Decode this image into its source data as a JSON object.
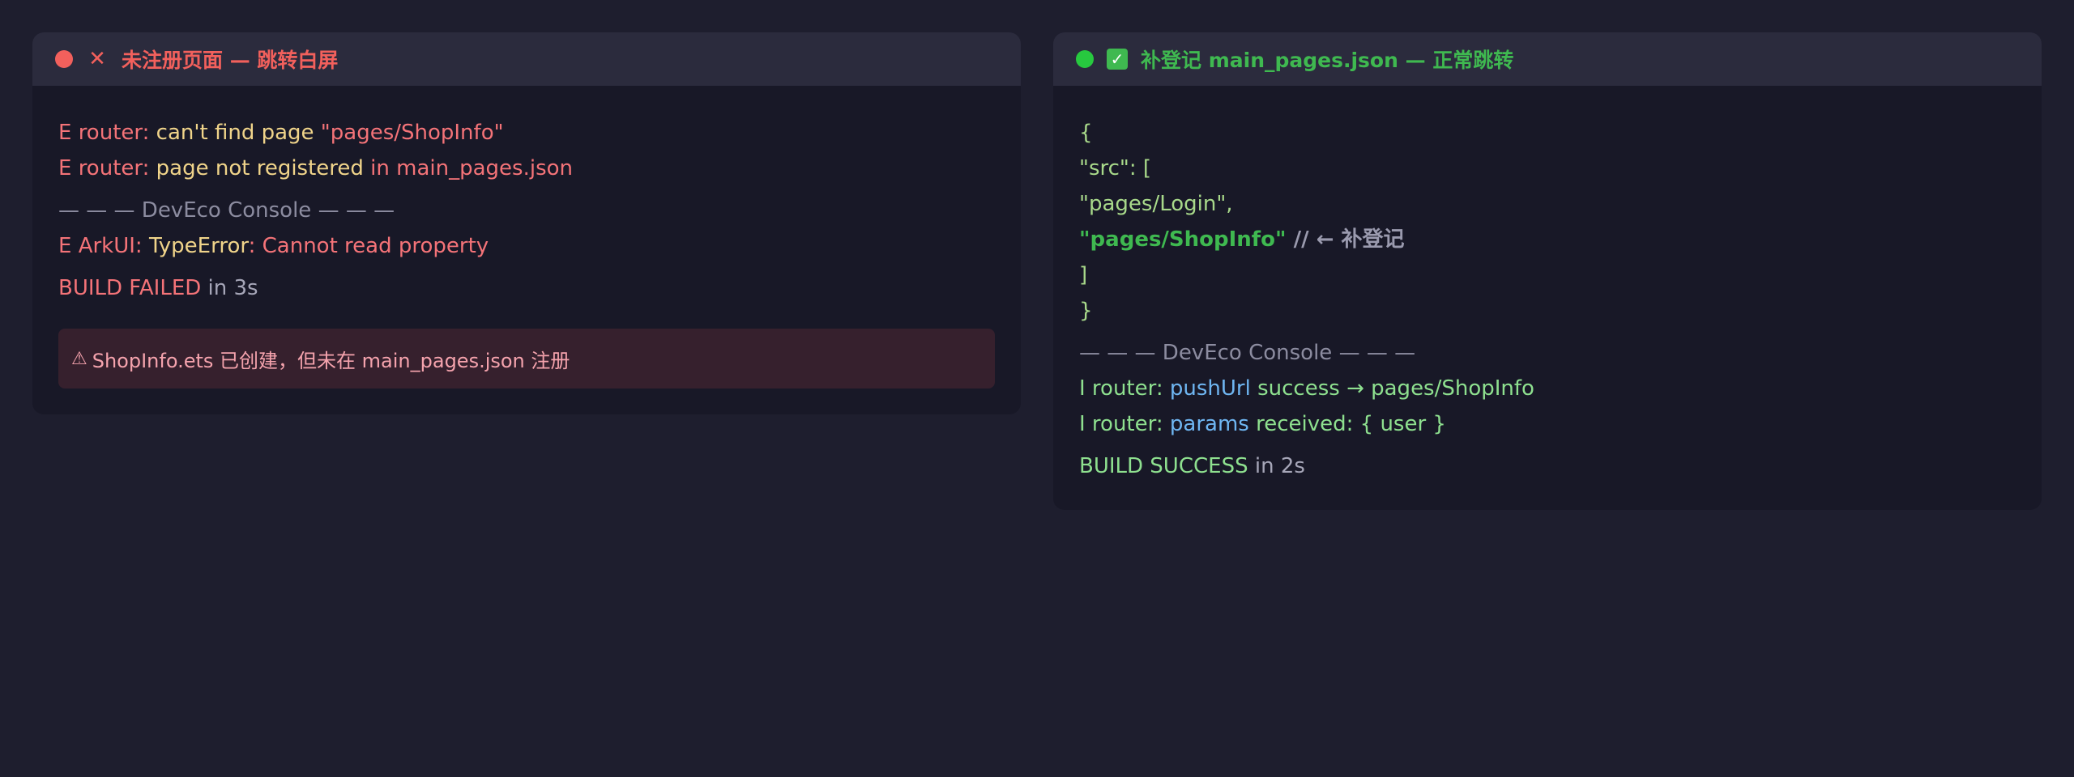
{
  "left_panel": {
    "title": "未注册页面 — 跳转白屏",
    "colors": {
      "dot": "#f2605c",
      "title": "#f2605c"
    },
    "lines": {
      "l1": {
        "prefix": "E router: ",
        "msg": "can't find page ",
        "path": "\"pages/ShopInfo\""
      },
      "l2": {
        "prefix": "E router: ",
        "msg": "page not registered ",
        "suffix": "in main_pages.json"
      },
      "separator": "— — — DevEco Console — — —",
      "l3": {
        "prefix": "E ArkUI: ",
        "type": "TypeError",
        "colon": ": ",
        "msg": "Cannot read property"
      },
      "build": {
        "status": "BUILD FAILED",
        "time": " in 3s"
      }
    },
    "warning": {
      "icon": "⚠",
      "text": "ShopInfo.ets 已创建，但未在 main_pages.json 注册"
    }
  },
  "right_panel": {
    "title": "补登记 main_pages.json — 正常跳转",
    "colors": {
      "dot": "#27c93f",
      "title": "#3fb950"
    },
    "code": {
      "open_brace": "{",
      "src_line": "\"src\": [",
      "login": "\"pages/Login\",",
      "shopinfo": "\"pages/ShopInfo\"",
      "comment": " // ← 补登记",
      "close_bracket": "]",
      "close_brace": "}"
    },
    "separator": "— — — DevEco Console — — —",
    "l1": {
      "prefix": "I router: ",
      "method": "pushUrl",
      "msg": " success → pages/ShopInfo"
    },
    "l2": {
      "prefix": "I router: ",
      "key": "params",
      "msg": " received: { user }"
    },
    "build": {
      "status": "BUILD SUCCESS",
      "time": " in 2s"
    }
  }
}
